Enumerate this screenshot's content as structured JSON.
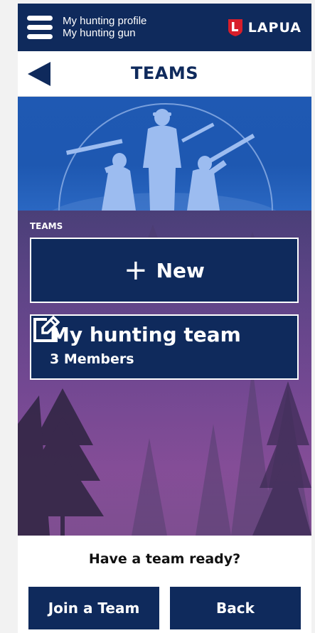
{
  "header": {
    "menu_links": [
      "My hunting profile",
      "My hunting gun"
    ],
    "brand_name": "LAPUA",
    "brand_shield_letter": "L",
    "brand_color": "#d81e2a",
    "primary_color": "#0f2a5c"
  },
  "titlebar": {
    "title": "TEAMS",
    "back_icon": "back-arrow-icon"
  },
  "teams_section": {
    "label": "TEAMS",
    "new_button": {
      "icon": "+",
      "label": "New"
    },
    "teams": [
      {
        "name": "My hunting team",
        "members": "3 Members",
        "edit_icon": "edit-icon"
      }
    ]
  },
  "footer": {
    "prompt": "Have a team ready?",
    "join_label": "Join a Team",
    "back_label": "Back"
  }
}
